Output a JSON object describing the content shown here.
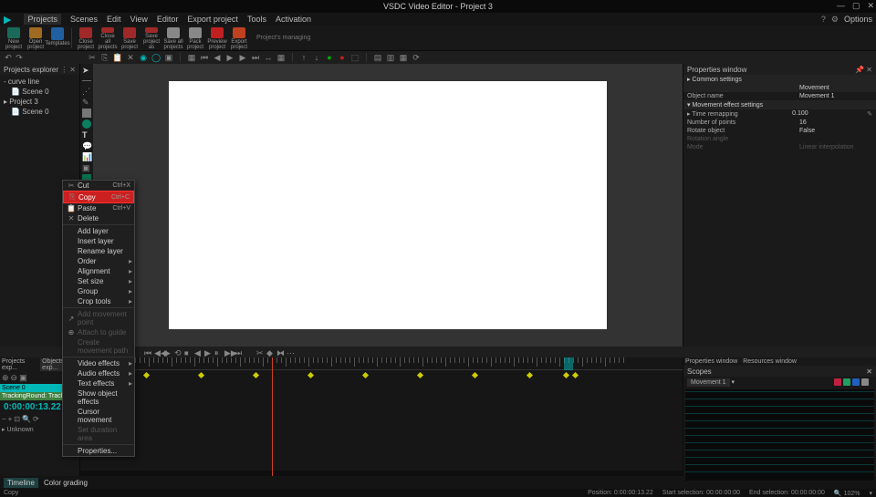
{
  "app": {
    "title": "VSDC Video Editor - Project 3"
  },
  "menu": {
    "items": [
      "Projects",
      "Scenes",
      "Edit",
      "View",
      "Editor",
      "Export project",
      "Tools",
      "Activation"
    ],
    "options": "Options"
  },
  "toolbar": {
    "new_project": "New project",
    "open_project": "Open project",
    "templates": "Templates",
    "close_project": "Close project",
    "close_all": "Close all projects",
    "save_project": "Save project",
    "save_as": "Save project as",
    "save_all": "Save all projects",
    "pack": "Pack project",
    "preview": "Preview project",
    "export": "Export project",
    "group": "Project's managing"
  },
  "explorer": {
    "title": "Projects explorer",
    "nodes": [
      {
        "label": "curve line",
        "indent": 0
      },
      {
        "label": "Scene 0",
        "indent": 1
      },
      {
        "label": "Project 3",
        "indent": 0
      },
      {
        "label": "Scene 0",
        "indent": 1
      }
    ]
  },
  "ctx": {
    "cut": {
      "label": "Cut",
      "sc": "Ctrl+X"
    },
    "copy": {
      "label": "Copy",
      "sc": "Ctrl+C"
    },
    "paste": {
      "label": "Paste",
      "sc": "Ctrl+V"
    },
    "delete": {
      "label": "Delete"
    },
    "addlayer": {
      "label": "Add layer"
    },
    "insertlayer": {
      "label": "Insert layer"
    },
    "renamelayer": {
      "label": "Rename layer"
    },
    "order": {
      "label": "Order"
    },
    "alignment": {
      "label": "Alignment"
    },
    "setsize": {
      "label": "Set size"
    },
    "group": {
      "label": "Group"
    },
    "crop": {
      "label": "Crop tools"
    },
    "mvtpoint": {
      "label": "Add movement point"
    },
    "attach": {
      "label": "Attach to guide"
    },
    "create_mvt": {
      "label": "Create movement path"
    },
    "video_fx": {
      "label": "Video effects"
    },
    "audio_fx": {
      "label": "Audio effects"
    },
    "text_fx": {
      "label": "Text effects"
    },
    "show_fx": {
      "label": "Show object effects"
    },
    "cursor_mvt": {
      "label": "Cursor movement"
    },
    "set_duration": {
      "label": "Set duration area"
    },
    "props": {
      "label": "Properties..."
    }
  },
  "props": {
    "title": "Properties window",
    "common": "Common settings",
    "movement_hdr": "Movement",
    "obj_name_k": "Object name",
    "obj_name_v": "Movement 1",
    "mvt_settings": "Movement effect settings",
    "time_remap_k": "Time remapping",
    "time_remap_v": "0.100",
    "num_points_k": "Number of points",
    "num_points_v": "16",
    "rotate_k": "Rotate object",
    "rotate_v": "False",
    "rot_angle_k": "Rotation angle",
    "mode_k": "Mode",
    "mode_v": "Linear interpolation"
  },
  "timeline": {
    "scene_tab": "Scene 0",
    "track": "TrackingRound: Tracking",
    "timecode": "0:00:00:13.22",
    "movement": "Movement 1",
    "props_tab": "Properties window",
    "res_tab": "Resources window",
    "scopes": "Scopes",
    "unknown": "Unknown"
  },
  "status": {
    "timeline_tab": "Timeline",
    "color_tab": "Color grading"
  },
  "footer": {
    "hint": "Copy",
    "pos_k": "Position:",
    "pos_v": "0:00:00:13.22",
    "start_k": "Start selection:",
    "start_v": "00:00:00:00",
    "end_k": "End selection:",
    "end_v": "00:00:00:00",
    "zoom": "102%"
  },
  "colors": {
    "teal": "#00b8b8"
  }
}
